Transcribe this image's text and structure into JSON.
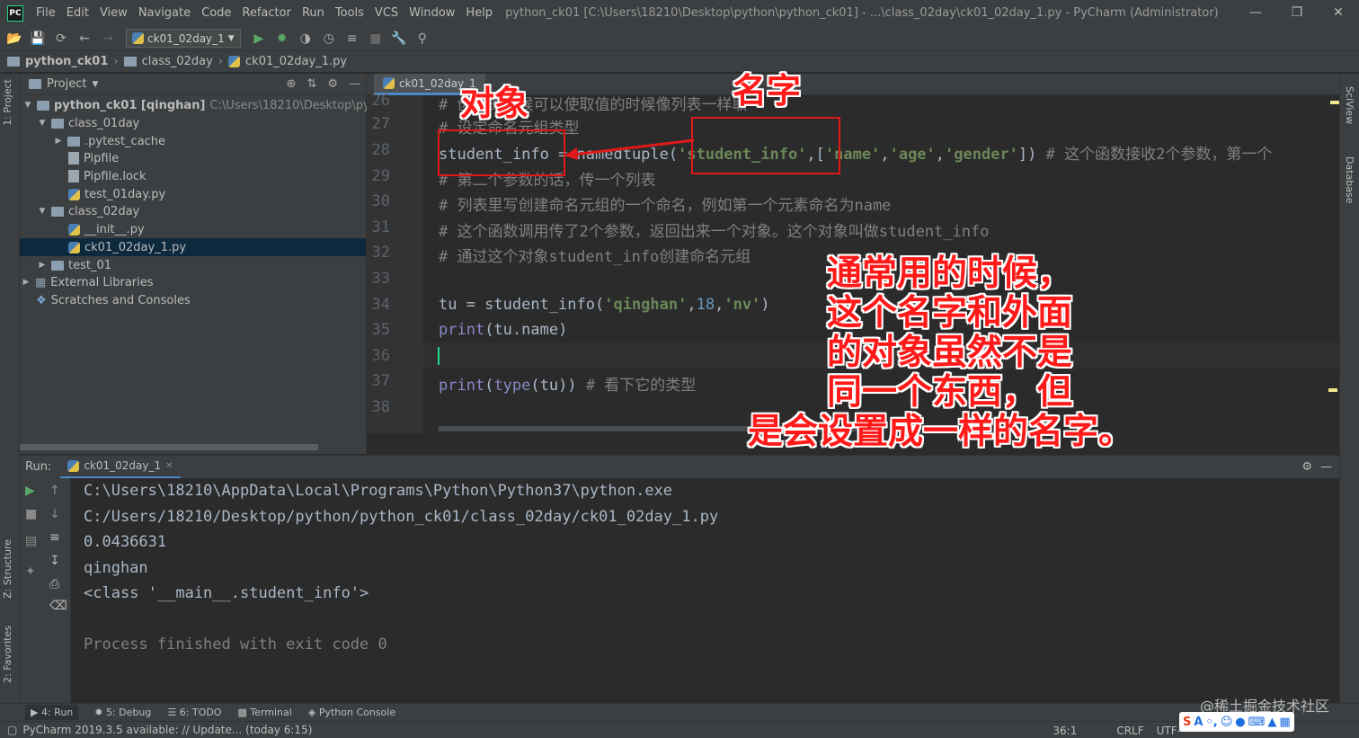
{
  "window": {
    "menu": [
      "File",
      "Edit",
      "View",
      "Navigate",
      "Code",
      "Refactor",
      "Run",
      "Tools",
      "VCS",
      "Window",
      "Help"
    ],
    "title": "python_ck01 [C:\\Users\\18210\\Desktop\\python\\python_ck01] - ...\\class_02day\\ck01_02day_1.py - PyCharm (Administrator)",
    "logo": "PC"
  },
  "toolbar": {
    "run_config": "ck01_02day_1"
  },
  "breadcrumb": [
    "python_ck01",
    "class_02day",
    "ck01_02day_1.py"
  ],
  "side_tabs": {
    "project": "1: Project",
    "structure": "Z: Structure",
    "favorites": "2: Favorites",
    "sciview": "SciView",
    "database": "Database"
  },
  "project": {
    "header": "Project",
    "root_name": "python_ck01 [qinghan]",
    "root_path": "C:\\Users\\18210\\Desktop\\python\\py",
    "items": [
      {
        "label": "class_01day"
      },
      {
        "label": ".pytest_cache"
      },
      {
        "label": "Pipfile"
      },
      {
        "label": "Pipfile.lock"
      },
      {
        "label": "test_01day.py"
      },
      {
        "label": "class_02day"
      },
      {
        "label": "__init__.py"
      },
      {
        "label": "ck01_02day_1.py"
      },
      {
        "label": "test_01"
      },
      {
        "label": "External Libraries"
      },
      {
        "label": "Scratches and Consoles"
      }
    ]
  },
  "editor": {
    "tab": "ck01_02day_1",
    "line_numbers": [
      "26",
      "27",
      "28",
      "29",
      "30",
      "31",
      "32",
      "33",
      "34",
      "35",
      "36",
      "37",
      "38"
    ],
    "l26": "# 创建的时候可以使取值的时候像列表一样取",
    "l27": "# 设定命名元组类型",
    "l28": {
      "var": "student_info",
      "op": " = namedtuple(",
      "s1": "'student_info'",
      "c1": ",",
      "lb": "[",
      "s2": "'name'",
      "c2": ",",
      "s3": "'age'",
      "c3": ",",
      "s4": "'gender'",
      "rb": "])",
      "comment": " # 这个函数接收2个参数，第一个"
    },
    "l29": "# 第二个参数的话，传一个列表",
    "l30": "# 列表里写创建命名元组的一个命名，例如第一个元素命名为name",
    "l31": "# 这个函数调用传了2个参数，返回出来一个对象。这个对象叫做student_info",
    "l32": "# 通过这个对象student_info创建命名元组",
    "l34": {
      "a": "tu = student_info(",
      "s1": "'qinghan'",
      "c1": ",",
      "n": "18",
      "c2": ",",
      "s2": "'nv'",
      "b": ")"
    },
    "l35": {
      "fn": "print",
      "rest": "(tu.name)"
    },
    "l37": {
      "fn": "print",
      "p": "(",
      "fn2": "type",
      "rest": "(tu))",
      "comment": " # 看下它的类型"
    }
  },
  "annotations": {
    "object_label": "对象",
    "name_label": "名字",
    "note_lines": [
      "通常用的时候，",
      "这个名字和外面",
      "的对象虽然不是",
      "同一个东西，但",
      "是会设置成一样的名字。"
    ]
  },
  "run": {
    "label": "Run:",
    "tab": "ck01_02day_1",
    "output": [
      "C:\\Users\\18210\\AppData\\Local\\Programs\\Python\\Python37\\python.exe",
      " C:/Users/18210/Desktop/python/python_ck01/class_02day/ck01_02day_1.py",
      "0.0436631",
      "qinghan",
      "<class '__main__.student_info'>",
      "",
      "Process finished with exit code 0"
    ]
  },
  "tool_windows": [
    "4: Run",
    "5: Debug",
    "6: TODO",
    "Terminal",
    "Python Console"
  ],
  "status": {
    "message": "PyCharm 2019.3.5 available: // Update... (today 6:15)",
    "position": "36:1",
    "line_sep": "CRLF",
    "encoding": "UTF-"
  },
  "watermark": "@稀土掘金技术社区"
}
